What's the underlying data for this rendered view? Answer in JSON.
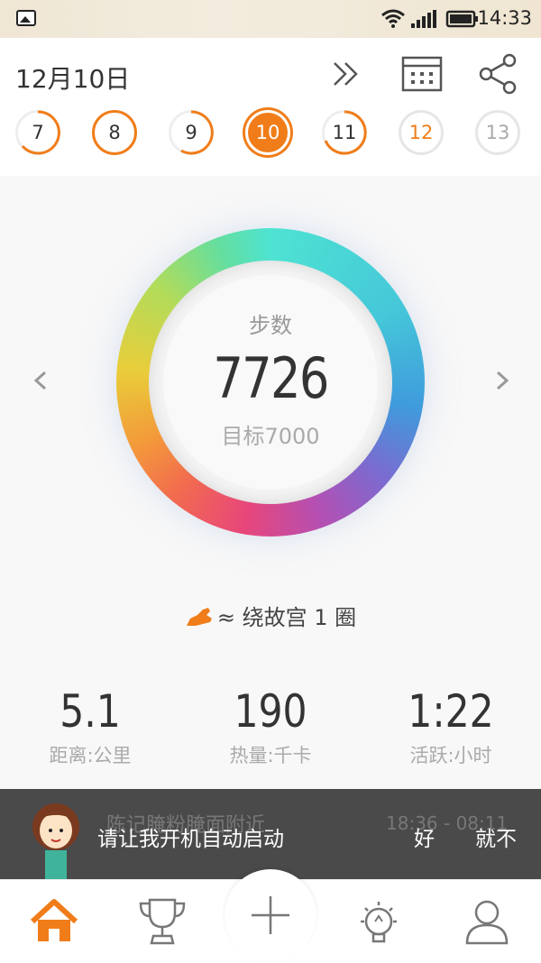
{
  "statusbar": {
    "time": "14:33",
    "icons": [
      "gallery-icon",
      "wifi-icon",
      "signal-icon",
      "battery-icon"
    ]
  },
  "header": {
    "date": "12月10日",
    "icons": [
      "double-chevron-right-icon",
      "calendar-icon",
      "share-icon"
    ],
    "days": [
      {
        "label": "7",
        "state": "partial"
      },
      {
        "label": "8",
        "state": "partial"
      },
      {
        "label": "9",
        "state": "partial"
      },
      {
        "label": "10",
        "state": "selected"
      },
      {
        "label": "11",
        "state": "partial"
      },
      {
        "label": "12",
        "state": "today"
      },
      {
        "label": "13",
        "state": "future"
      }
    ]
  },
  "ring": {
    "label": "步数",
    "steps": "7726",
    "goal_text": "目标7000"
  },
  "equivalence": {
    "icon": "shoe-icon",
    "text": "≈ 绕故宫 1 圈"
  },
  "stats": [
    {
      "value": "5.1",
      "label": "距离:公里"
    },
    {
      "value": "190",
      "label": "热量:千卡"
    },
    {
      "value": "1:22",
      "label": "活跃:小时"
    }
  ],
  "toast": {
    "behind_text": "陈记腌粉腌面附近",
    "behind_time": "18:36 - 08:11",
    "message": "请让我开机自动启动",
    "ok": "好",
    "no": "就不"
  },
  "tabbar": [
    "home-icon",
    "trophy-icon",
    "plus-icon",
    "insight-bulb-icon",
    "profile-icon"
  ],
  "colors": {
    "accent": "#f07d1a",
    "gray_circle": "#dcdcdc",
    "toast_bg": "#4a4a4a"
  }
}
